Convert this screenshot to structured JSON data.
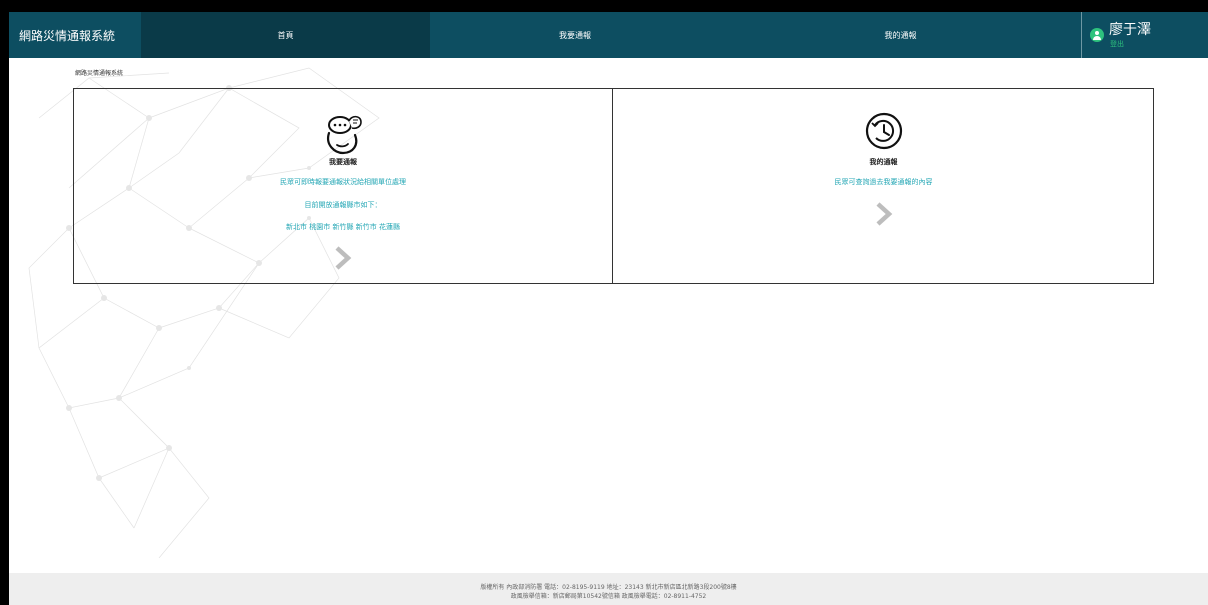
{
  "header": {
    "brand": "網路災情通報系統",
    "nav": [
      "首頁",
      "我要通報",
      "我的通報"
    ],
    "user_name": "廖于澤",
    "logout": "登出"
  },
  "breadcrumb": "網路災情通報系統",
  "cards": {
    "report": {
      "title": "我要通報",
      "lines": [
        "民眾可即時報要通報狀況給相關單位處理",
        "目前開放通報縣市如下：",
        "新北市  桃園市  新竹縣  新竹市  花蓮縣"
      ]
    },
    "my": {
      "title": "我的通報",
      "lines": [
        "民眾可查詢過去我要通報的內容"
      ]
    }
  },
  "footer": {
    "line1": "版權所有 內政部消防署 電話：02-8195-9119 地址：23143 新北市新店區北新路3段200號8樓",
    "line2": "政風檢舉信箱：新店郵局第10542號信箱 政風檢舉電話：02-8911-4752"
  },
  "colors": {
    "header_bg": "#0d4e61",
    "header_active": "#0a3a48",
    "accent": "#25a7b5",
    "user_dot": "#2ec27e"
  }
}
